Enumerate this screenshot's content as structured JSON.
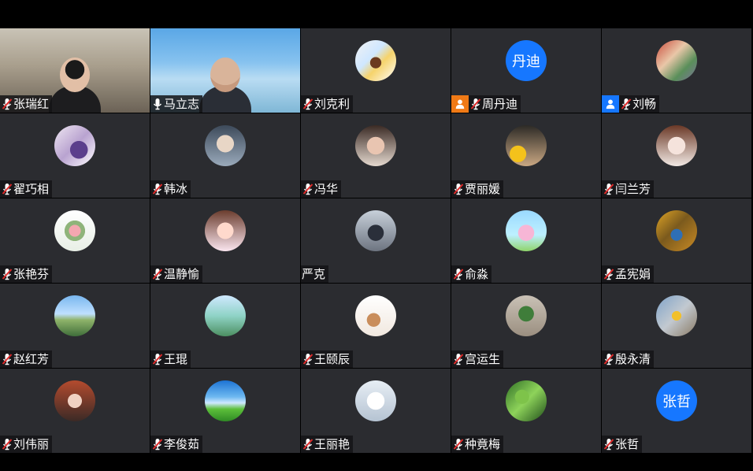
{
  "colors": {
    "tile_bg": "#2b2c30",
    "host_badge": "#f07a16",
    "cohost_badge": "#1677ff",
    "text_avatar": "#1677ff",
    "mic_muted": "#e02a2a"
  },
  "participants": [
    {
      "name": "张瑞红",
      "mic": "muted",
      "media": "video-a"
    },
    {
      "name": "马立志",
      "mic": "on",
      "media": "video-b"
    },
    {
      "name": "刘克利",
      "mic": "muted",
      "media": "avatar",
      "avatar": "guitar-photo"
    },
    {
      "name": "周丹迪",
      "mic": "muted",
      "media": "text-avatar",
      "avatar_text": "丹迪",
      "badge": "host"
    },
    {
      "name": "刘畅",
      "mic": "muted",
      "media": "avatar",
      "avatar": "illustration",
      "badge": "cohost"
    },
    {
      "name": "翟巧相",
      "mic": "muted",
      "media": "avatar",
      "avatar": "lavender-photo"
    },
    {
      "name": "韩冰",
      "mic": "muted",
      "media": "avatar",
      "avatar": "anime-boy"
    },
    {
      "name": "冯华",
      "mic": "muted",
      "media": "avatar",
      "avatar": "woman-photo"
    },
    {
      "name": "贾丽媛",
      "mic": "muted",
      "media": "avatar",
      "avatar": "woman-sunflower"
    },
    {
      "name": "闫兰芳",
      "mic": "muted",
      "media": "avatar",
      "avatar": "anime-girl"
    },
    {
      "name": "张艳芬",
      "mic": "muted",
      "media": "avatar",
      "avatar": "flower-bouquet"
    },
    {
      "name": "温静愉",
      "mic": "muted",
      "media": "avatar",
      "avatar": "cartoon-girl"
    },
    {
      "name": "严克",
      "mic": "none",
      "media": "avatar",
      "avatar": "man-street"
    },
    {
      "name": "俞淼",
      "mic": "muted",
      "media": "avatar",
      "avatar": "princess-cartoon"
    },
    {
      "name": "孟宪娟",
      "mic": "muted",
      "media": "avatar",
      "avatar": "autumn-trees"
    },
    {
      "name": "赵红芳",
      "mic": "muted",
      "media": "avatar",
      "avatar": "park-photo"
    },
    {
      "name": "王琨",
      "mic": "muted",
      "media": "avatar",
      "avatar": "stairs-sky"
    },
    {
      "name": "王颐辰",
      "mic": "muted",
      "media": "avatar",
      "avatar": "pipa-drawing"
    },
    {
      "name": "宫运生",
      "mic": "muted",
      "media": "avatar",
      "avatar": "potted-plant"
    },
    {
      "name": "殷永清",
      "mic": "muted",
      "media": "avatar",
      "avatar": "yellow-flowers"
    },
    {
      "name": "刘伟丽",
      "mic": "muted",
      "media": "avatar",
      "avatar": "woman-redhair"
    },
    {
      "name": "李俊茹",
      "mic": "muted",
      "media": "avatar",
      "avatar": "green-field"
    },
    {
      "name": "王丽艳",
      "mic": "muted",
      "media": "avatar",
      "avatar": "robot-baymax"
    },
    {
      "name": "种竟梅",
      "mic": "muted",
      "media": "avatar",
      "avatar": "green-leaves"
    },
    {
      "name": "张哲",
      "mic": "muted",
      "media": "text-avatar",
      "avatar_text": "张哲"
    }
  ]
}
